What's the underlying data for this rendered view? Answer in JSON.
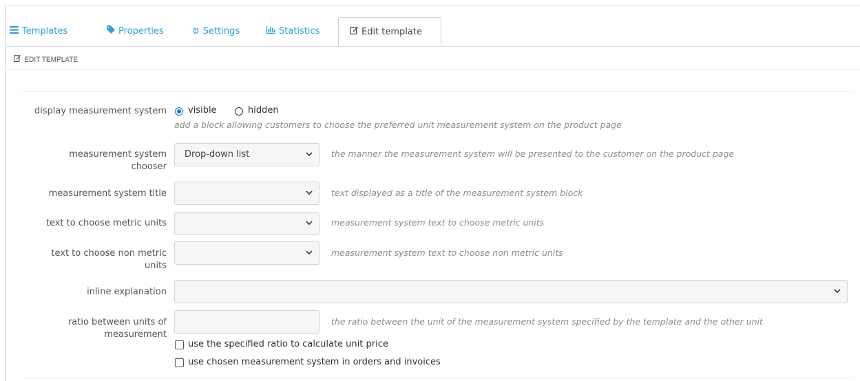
{
  "tabs": [
    {
      "icon": "list-icon",
      "label": "Templates"
    },
    {
      "icon": "tag-icon",
      "label": "Properties"
    },
    {
      "icon": "gear-icon",
      "label": "Settings"
    },
    {
      "icon": "bar-chart-icon",
      "label": "Statistics"
    },
    {
      "icon": "edit-icon",
      "label": "Edit template",
      "active": true
    }
  ],
  "panel": {
    "icon": "edit-icon",
    "title": "EDIT TEMPLATE"
  },
  "form": {
    "display_measurement_system": {
      "label": "display measurement system",
      "options": [
        "visible",
        "hidden"
      ],
      "selected": "visible",
      "help": "add a block allowing customers to choose the preferred unit measurement system on the product page"
    },
    "measurement_system_chooser": {
      "label": "measurement system chooser",
      "value": "Drop-down list",
      "help": "the manner the measurement system will be presented to the customer on the product page"
    },
    "measurement_system_title": {
      "label": "measurement system title",
      "value": "",
      "help": "text displayed as a title of the measurement system block"
    },
    "text_metric_units": {
      "label": "text to choose metric units",
      "value": "",
      "help": "measurement system text to choose metric units"
    },
    "text_non_metric_units": {
      "label": "text to choose non metric units",
      "value": "",
      "help": "measurement system text to choose non metric units"
    },
    "inline_explanation": {
      "label": "inline explanation",
      "value": ""
    },
    "ratio_between_units": {
      "label": "ratio between units of measurement",
      "value": "",
      "help": "the ratio between the unit of the measurement system specified by the template and the other unit"
    },
    "checkboxes": [
      {
        "label": "use the specified ratio to calculate unit price",
        "checked": false
      },
      {
        "label": "use chosen measurement system in orders and invoices",
        "checked": false
      }
    ]
  },
  "colors": {
    "accent": "#2e9fd8",
    "radio": "#1a73e8",
    "help_text": "#8d8d8d"
  }
}
